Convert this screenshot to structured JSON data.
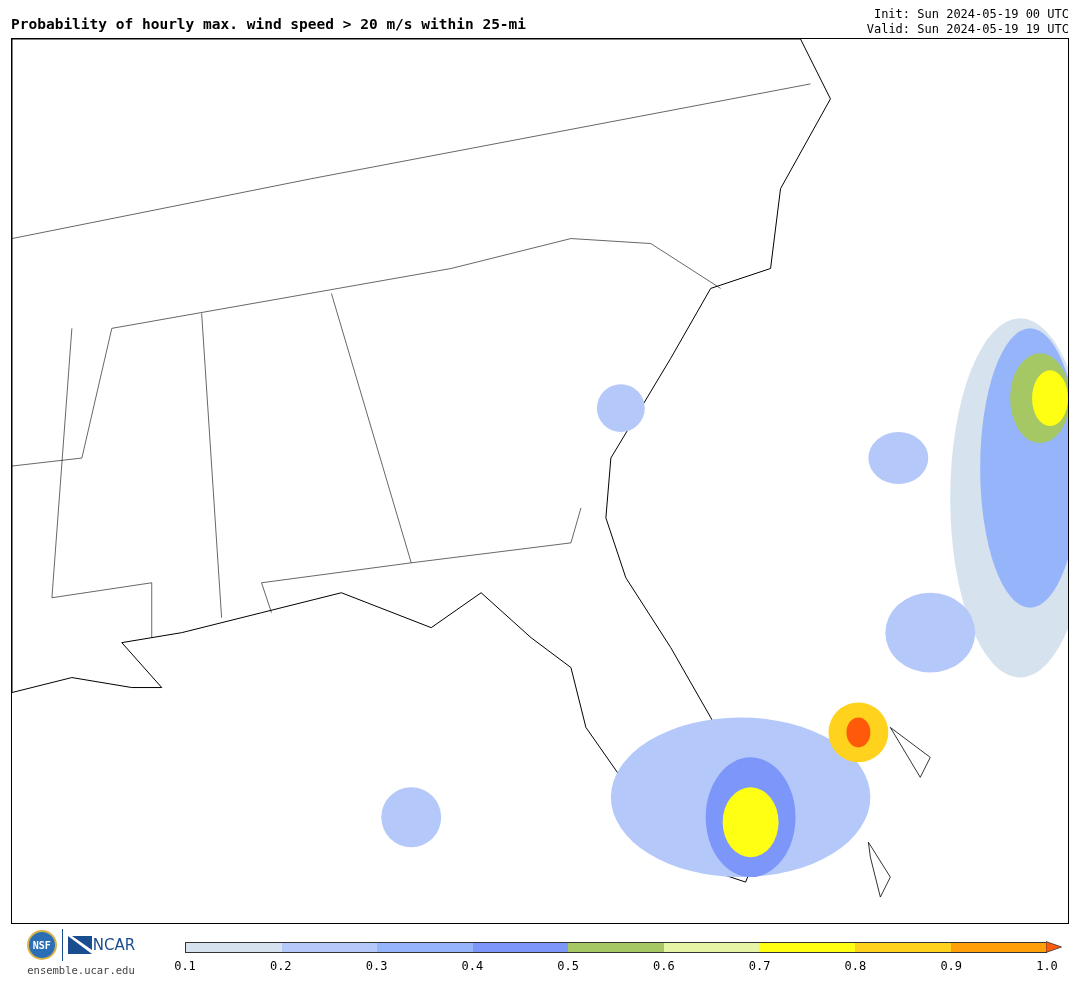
{
  "title": "Probability of hourly max. wind speed > 20 m/s within 25-mi",
  "init": "Init: Sun 2024-05-19 00 UTC",
  "valid": "Valid: Sun 2024-05-19 19 UTC",
  "logos": {
    "nsf": "NSF",
    "ncar": "NCAR",
    "site": "ensemble.ucar.edu"
  },
  "colorbar": {
    "bins": [
      {
        "color": "#d6e2ed"
      },
      {
        "color": "#b4c8fa"
      },
      {
        "color": "#96b4fa"
      },
      {
        "color": "#7d96fa"
      },
      {
        "color": "#a5c864"
      },
      {
        "color": "#e6f5a5"
      },
      {
        "color": "#ffff14"
      },
      {
        "color": "#ffd21e"
      },
      {
        "color": "#ffa00a"
      }
    ],
    "extension": {
      "color": "#ff5a0a"
    },
    "ticks": [
      "0.1",
      "0.2",
      "0.3",
      "0.4",
      "0.5",
      "0.6",
      "0.7",
      "0.8",
      "0.9",
      "1.0"
    ]
  }
}
